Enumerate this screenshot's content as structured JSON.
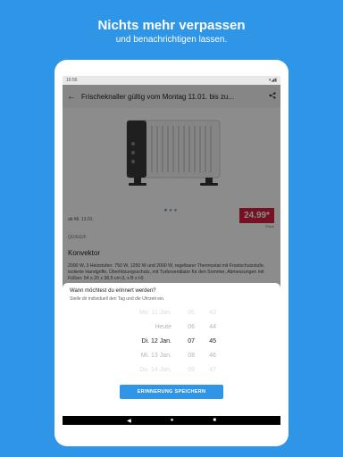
{
  "promo": {
    "title": "Nichts mehr verpassen",
    "subtitle": "und benachrichtigen lassen."
  },
  "statusbar": {
    "time": "16:56",
    "indicators": "▾◢▮"
  },
  "appbar": {
    "back_icon": "arrow-left-icon",
    "title": "Frischeknaller gültig vom Montag 11.01. bis zu...",
    "share_icon": "share-icon"
  },
  "product": {
    "validity": "ab Mi. 13.01.",
    "price": "24.99*",
    "price_unit": "Stück",
    "brand": "QUIGG®",
    "name": "Konvektor",
    "description": "2000 W, 3 Heizstufen: 750 W, 1250 W und 2000 W, regelbarer Thermostat mit Frostschutzstufe, isolierte Handgriffe, Überhitzungsschutz, mit Turboventilator für den Sommer, Abmessungen mit Füßen: 54 x 20 x 38,5 cm (L x B x H)"
  },
  "reminder": {
    "title": "Wann möchtest du erinnert werden?",
    "subtitle": "Stelle dir individuell den Tag und die Uhrzeit ein.",
    "rows": [
      {
        "date": "Mo. 11 Jan.",
        "hour": "05",
        "minute": "43"
      },
      {
        "date": "Heute",
        "hour": "06",
        "minute": "44"
      },
      {
        "date": "Di. 12 Jan.",
        "hour": "07",
        "minute": "45"
      },
      {
        "date": "Mi. 13 Jan.",
        "hour": "08",
        "minute": "46"
      },
      {
        "date": "Do. 14 Jan.",
        "hour": "09",
        "minute": "47"
      }
    ],
    "save_label": "ERINNERUNG SPEICHERN"
  },
  "navbar": {
    "back": "◀",
    "home": "●",
    "recents": "■"
  },
  "colors": {
    "accent": "#2f95e6",
    "price_bg": "#d5203e"
  }
}
